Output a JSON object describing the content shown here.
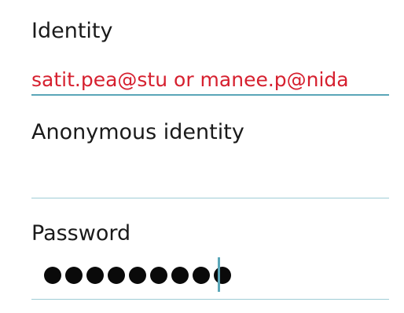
{
  "fields": {
    "identity": {
      "label": "Identity",
      "value": "satit.pea@stu or manee.p@nida",
      "value_color": "#d6202f"
    },
    "anonymous_identity": {
      "label": "Anonymous identity",
      "value": ""
    },
    "password": {
      "label": "Password",
      "masked_length": 9
    }
  },
  "colors": {
    "label_text": "#1a1a1a",
    "underline": "#6fb3c2",
    "accent": "#5aa6b8"
  }
}
